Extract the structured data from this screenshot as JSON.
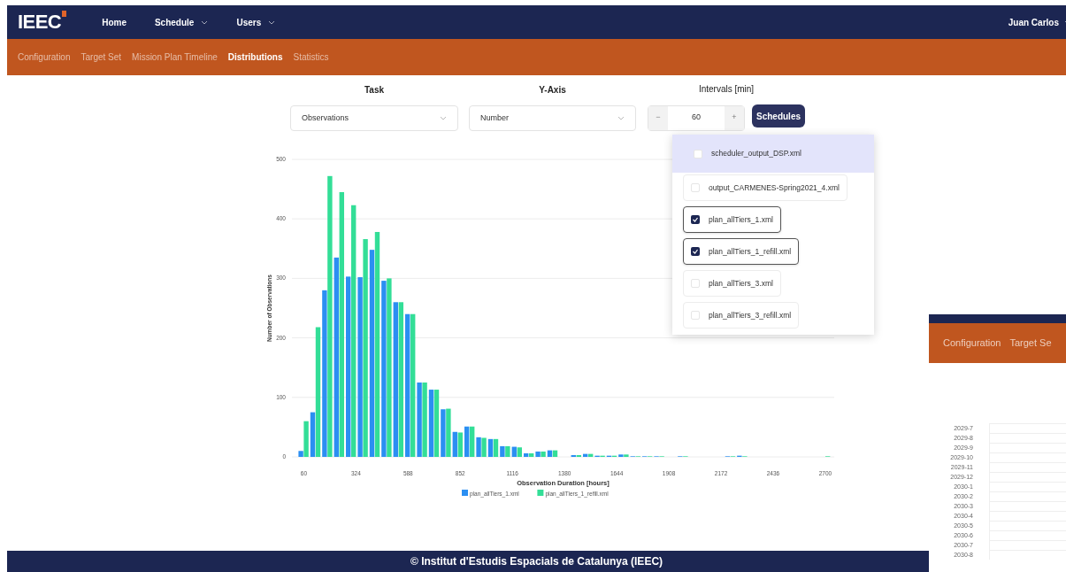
{
  "navbar": {
    "logo": "IEEC",
    "items": [
      {
        "label": "Home",
        "dropdown": false
      },
      {
        "label": "Schedule",
        "dropdown": true
      },
      {
        "label": "Users",
        "dropdown": true
      }
    ],
    "user": "Juan Carlos"
  },
  "tabs": [
    {
      "label": "Configuration",
      "selected": false
    },
    {
      "label": "Target Set",
      "selected": false
    },
    {
      "label": "Mission Plan Timeline",
      "selected": false
    },
    {
      "label": "Distributions",
      "selected": true
    },
    {
      "label": "Statistics",
      "selected": false
    }
  ],
  "controls": {
    "task": {
      "label": "Task",
      "value": "Observations"
    },
    "y_axis": {
      "label": "Y-Axis",
      "value": "Number"
    },
    "intervals": {
      "label": "Intervals [min]",
      "minus": "−",
      "value": "60",
      "plus": "+"
    },
    "schedules_button": "Schedules"
  },
  "schedules_menu": [
    {
      "label": "scheduler_output_DSP.xml",
      "checked": false,
      "highlighted": true
    },
    {
      "label": "output_CARMENES-Spring2021_4.xml",
      "checked": false,
      "highlighted": false
    },
    {
      "label": "plan_allTiers_1.xml",
      "checked": true,
      "highlighted": false
    },
    {
      "label": "plan_allTiers_1_refill.xml",
      "checked": true,
      "highlighted": false
    },
    {
      "label": "plan_allTiers_3.xml",
      "checked": false,
      "highlighted": false
    },
    {
      "label": "plan_allTiers_3_refill.xml",
      "checked": false,
      "highlighted": false
    }
  ],
  "chart_data": {
    "type": "bar",
    "xlabel": "Observation Duration [hours]",
    "ylabel": "Number of Observations",
    "x": [
      60,
      120,
      180,
      240,
      300,
      360,
      420,
      480,
      540,
      600,
      660,
      720,
      780,
      840,
      900,
      960,
      1020,
      1080,
      1140,
      1200,
      1260,
      1320,
      1380,
      1440,
      1500,
      1560,
      1620,
      1680,
      1740,
      1800,
      1860,
      1920,
      1980,
      2040,
      2100,
      2160,
      2220,
      2280,
      2340,
      2400,
      2460,
      2520,
      2580,
      2640,
      2700
    ],
    "series": [
      {
        "name": "plan_allTiers_1.xml",
        "color": "#2b8ff2",
        "values": [
          10,
          75,
          280,
          335,
          303,
          302,
          348,
          296,
          260,
          240,
          125,
          113,
          80,
          42,
          51,
          33,
          30,
          18,
          17,
          6,
          9,
          11,
          0,
          3,
          5,
          2,
          2,
          4,
          1,
          1,
          1,
          0,
          1,
          0,
          0,
          0,
          1,
          2,
          0,
          0,
          0,
          0,
          0,
          0,
          0
        ]
      },
      {
        "name": "plan_allTiers_1_refill.xml",
        "color": "#33de97",
        "values": [
          60,
          218,
          472,
          445,
          423,
          366,
          378,
          300,
          260,
          240,
          125,
          113,
          81,
          41,
          51,
          32,
          30,
          18,
          16,
          6,
          9,
          11,
          0,
          3,
          5,
          2,
          2,
          4,
          1,
          1,
          1,
          0,
          1,
          0,
          0,
          0,
          1,
          1,
          0,
          0,
          0,
          0,
          0,
          0,
          1
        ]
      }
    ],
    "xlim": [
      0,
      2745
    ],
    "grid": true,
    "legend": true,
    "ylim": [
      0,
      500
    ],
    "xticks": [
      60,
      324,
      588,
      852,
      1116,
      1380,
      1644,
      1908,
      2172,
      2436,
      2700
    ],
    "yticks": [
      0,
      100,
      200,
      300,
      400,
      500
    ]
  },
  "footer": "© Institut d'Estudis Espacials de Catalunya (IEEC)",
  "background_window": {
    "tabs": [
      "Configuration",
      "Target Se"
    ],
    "row_labels": [
      "2029-7",
      "2029-8",
      "2029-9",
      "2029-10",
      "2029-11",
      "2029-12",
      "2030-1",
      "2030-2",
      "2030-3",
      "2030-4",
      "2030-5",
      "2030-6",
      "2030-7",
      "2030-8"
    ]
  }
}
